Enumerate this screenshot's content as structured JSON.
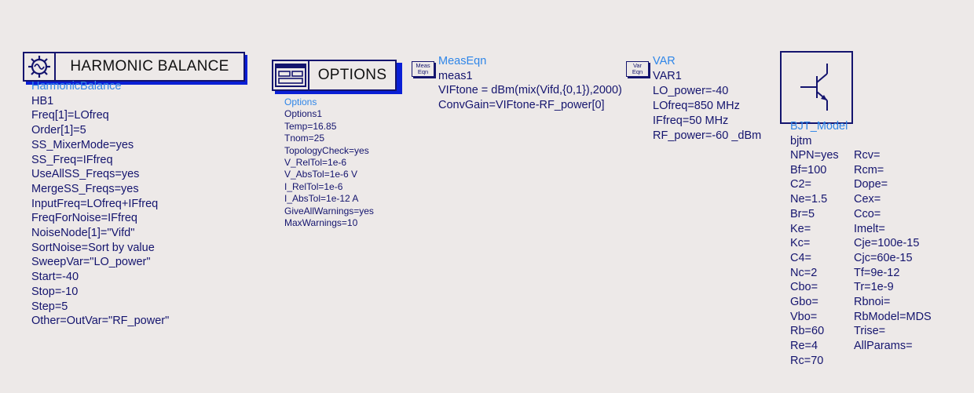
{
  "harmonic_balance": {
    "title": "HARMONIC BALANCE",
    "type_label": "HarmonicBalance",
    "instance": "HB1",
    "params": [
      "Freq[1]=LOfreq",
      "Order[1]=5",
      "SS_MixerMode=yes",
      "SS_Freq=IFfreq",
      "UseAllSS_Freqs=yes",
      "MergeSS_Freqs=yes",
      "InputFreq=LOfreq+IFfreq",
      "FreqForNoise=IFfreq",
      "NoiseNode[1]=\"Vifd\"",
      "SortNoise=Sort by value",
      "SweepVar=\"LO_power\"",
      "Start=-40",
      "Stop=-10",
      "Step=5",
      "Other=OutVar=\"RF_power\""
    ]
  },
  "options": {
    "title": "OPTIONS",
    "type_label": "Options",
    "instance": "Options1",
    "params": [
      "Temp=16.85",
      "Tnom=25",
      "TopologyCheck=yes",
      "V_RelTol=1e-6",
      "V_AbsTol=1e-6 V",
      "I_RelTol=1e-6",
      "I_AbsTol=1e-12 A",
      "GiveAllWarnings=yes",
      "MaxWarnings=10"
    ]
  },
  "meas_eqn": {
    "icon_line1": "Meas",
    "icon_line2": "Eqn",
    "type_label": "MeasEqn",
    "instance": "meas1",
    "params": [
      "VIFtone = dBm(mix(Vifd,{0,1}),2000)",
      "ConvGain=VIFtone-RF_power[0]"
    ]
  },
  "var": {
    "icon_line1": "Var",
    "icon_line2": "Eqn",
    "type_label": "VAR",
    "instance": "VAR1",
    "params": [
      "LO_power=-40",
      "LOfreq=850 MHz",
      "IFfreq=50 MHz",
      "RF_power=-60 _dBm"
    ]
  },
  "bjt_model": {
    "type_label": "BJT_Model",
    "instance": "bjtm",
    "params_left": [
      "NPN=yes",
      "Bf=100",
      "C2=",
      "Ne=1.5",
      "Br=5",
      "Ke=",
      "Kc=",
      "C4=",
      "Nc=2",
      "Cbo=",
      "Gbo=",
      "Vbo=",
      "Rb=60",
      "Re=4",
      "Rc=70"
    ],
    "params_right": [
      "Rcv=",
      "Rcm=",
      "Dope=",
      "Cex=",
      "Cco=",
      "Imelt=",
      "Cje=100e-15",
      "Cjc=60e-15",
      "Tf=9e-12",
      "Tr=1e-9",
      "Rbnoi=",
      "RbModel=MDS",
      "Trise=",
      "AllParams="
    ]
  },
  "colors": {
    "background": "#ede9e8",
    "text": "#14146e",
    "label_blue": "#2f86e8",
    "shadow_blue": "#0a1fd6"
  },
  "icons": {
    "harmonic_balance": "sine-wave-gear-icon",
    "options": "window-panel-icon",
    "bjt": "npn-transistor-icon"
  }
}
